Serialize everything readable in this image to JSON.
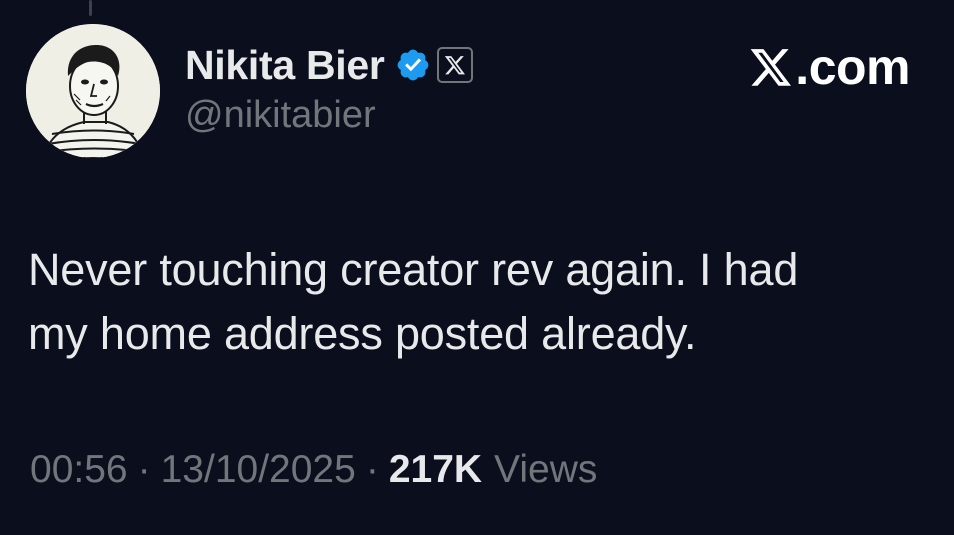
{
  "author": {
    "display_name": "Nikita Bier",
    "handle": "@nikitabier",
    "avatar_icon": "sketch-portrait-avatar",
    "verified_icon": "verified-check-icon",
    "affiliate_icon": "x-logo-icon",
    "verified_color": "#1d9bf0"
  },
  "brand": {
    "label": ".com",
    "icon": "x-logo-icon"
  },
  "tweet": {
    "lines": [
      "Never touching creator rev again. I had",
      "my home address posted already."
    ]
  },
  "meta": {
    "time": "00:56",
    "separator": "·",
    "date": "13/10/2025",
    "views_count": "217K",
    "views_label": "Views"
  },
  "colors": {
    "background": "#0b0e1d",
    "primary_text": "#e7e9ea",
    "secondary_text": "#71767b"
  }
}
